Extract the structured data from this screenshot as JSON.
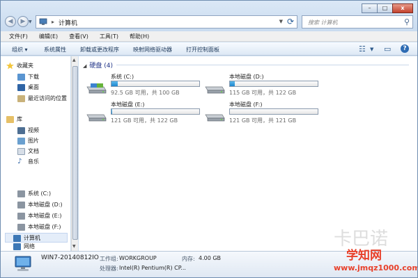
{
  "address_bar": {
    "location": "计算机",
    "separator": "▸",
    "search_placeholder": "搜索 计算机"
  },
  "window_buttons": {
    "minimize": "–",
    "maximize": "□",
    "close": "x"
  },
  "menu": [
    "文件(F)",
    "编辑(E)",
    "查看(V)",
    "工具(T)",
    "帮助(H)"
  ],
  "commands": {
    "organize": "组织 ▾",
    "system_properties": "系统属性",
    "uninstall": "卸载或更改程序",
    "map_drive": "映射网络驱动器",
    "control_panel": "打开控制面板"
  },
  "sidebar": {
    "favorites": {
      "title": "收藏夹",
      "items": [
        "下载",
        "桌面",
        "最近访问的位置"
      ]
    },
    "libraries": {
      "title": "库",
      "items": [
        "视频",
        "图片",
        "文档",
        "音乐"
      ]
    },
    "computer": {
      "title": "计算机",
      "items": [
        "系统 (C:)",
        "本地磁盘 (D:)",
        "本地磁盘 (E:)",
        "本地磁盘 (F:)"
      ]
    },
    "network": {
      "title": "网络"
    }
  },
  "main": {
    "group_title": "硬盘 (4)",
    "drives": [
      {
        "name": "系统 (C:)",
        "size_text": "92.5 GB 可用，共 100 GB",
        "used_fraction": 0.075
      },
      {
        "name": "本地磁盘 (D:)",
        "size_text": "115 GB 可用，共 122 GB",
        "used_fraction": 0.057
      },
      {
        "name": "本地磁盘 (E:)",
        "size_text": "121 GB 可用，共 122 GB",
        "used_fraction": 0.008
      },
      {
        "name": "本地磁盘 (F:)",
        "size_text": "121 GB 可用，共 121 GB",
        "used_fraction": 0.0
      }
    ]
  },
  "details": {
    "computer_name": "WIN7-20140812IO",
    "workgroup_label": "工作组:",
    "workgroup": "WORKGROUP",
    "memory_label": "内存:",
    "memory": "4.00 GB",
    "processor_label": "处理器:",
    "processor": "Intel(R) Pentium(R) CP..."
  },
  "watermark": {
    "logo": "学知网",
    "url": "www.jmqz1000.com"
  },
  "colors": {
    "bar_fill": "#1e86cd",
    "chrome": "#cfdff0",
    "accent_red": "#e8402a"
  }
}
